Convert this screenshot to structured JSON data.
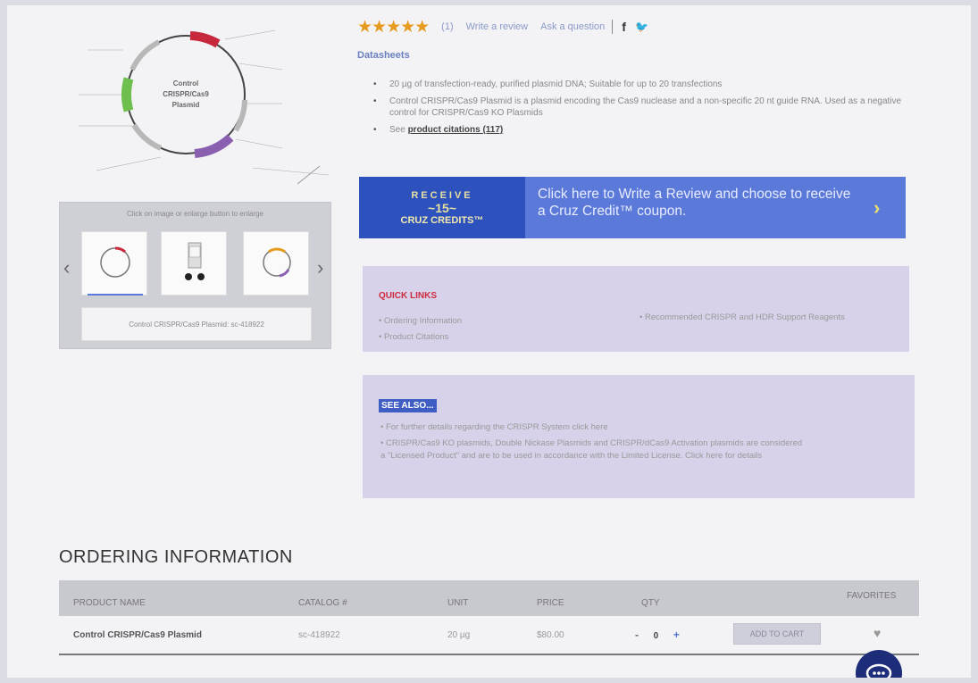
{
  "plasmid": {
    "title_line1": "Control",
    "title_line2": "CRISPR/Cas9",
    "title_line3": "Plasmid"
  },
  "gallery": {
    "hint": "Click on image or enlarge button to enlarge",
    "caption": "Control CRISPR/Cas9 Plasmid: sc-418922"
  },
  "rating": {
    "stars": "★★★★★",
    "count": "(1)",
    "write_review": "Write a review",
    "ask_question": "Ask a question"
  },
  "icons": {
    "facebook": "f",
    "twitter": "🐦",
    "prev": "‹",
    "next": "›",
    "banner_arrow": "›",
    "heart": "♥"
  },
  "datasheets": "Datasheets",
  "bullets": [
    "20 µg of transfection-ready, purified plasmid DNA; Suitable for up to 20 transfections",
    "Control CRISPR/Cas9 Plasmid is a plasmid encoding the Cas9 nuclease and a non-specific 20 nt guide RNA. Used as a negative control for CRISPR/Cas9 KO Plasmids"
  ],
  "citations": {
    "prefix": "See ",
    "link": "product citations (117)"
  },
  "banner": {
    "line1": "RECEIVE",
    "line2": "~15~",
    "line3": "CRUZ CREDITS™",
    "text": "Click here to Write a Review and choose to receive a Cruz Credit™ coupon."
  },
  "quick_links": {
    "title": "QUICK LINKS",
    "items": [
      "• Ordering Information",
      "• Product Citations",
      "• Recommended CRISPR and HDR Support Reagents"
    ]
  },
  "see_also": {
    "title": "SEE ALSO...",
    "items": [
      "• For further details regarding the CRISPR System click here",
      "• CRISPR/Cas9 KO plasmids, Double Nickase Plasmids and CRISPR/dCas9 Activation plasmids are considered a \"Licensed Product\" and are to be used in accordance with the Limited License. Click here for details"
    ]
  },
  "ordering": {
    "title": "ORDERING INFORMATION",
    "headers": {
      "product": "Product Name",
      "catalog": "Catalog #",
      "unit": "Unit",
      "price": "Price",
      "qty": "Qty",
      "favorites": "Favorites"
    },
    "row": {
      "product": "Control CRISPR/Cas9 Plasmid",
      "catalog": "sc-418922",
      "unit": "20 µg",
      "price": "$80.00",
      "qty_minus": "-",
      "qty": "0",
      "qty_plus": "+",
      "add_to_cart": "ADD TO CART"
    }
  },
  "colors": {
    "stars": "#e69a1e",
    "banner": "#5b79d9",
    "quick_links_title": "#cf2b3f",
    "chat": "#1e2d7a"
  }
}
